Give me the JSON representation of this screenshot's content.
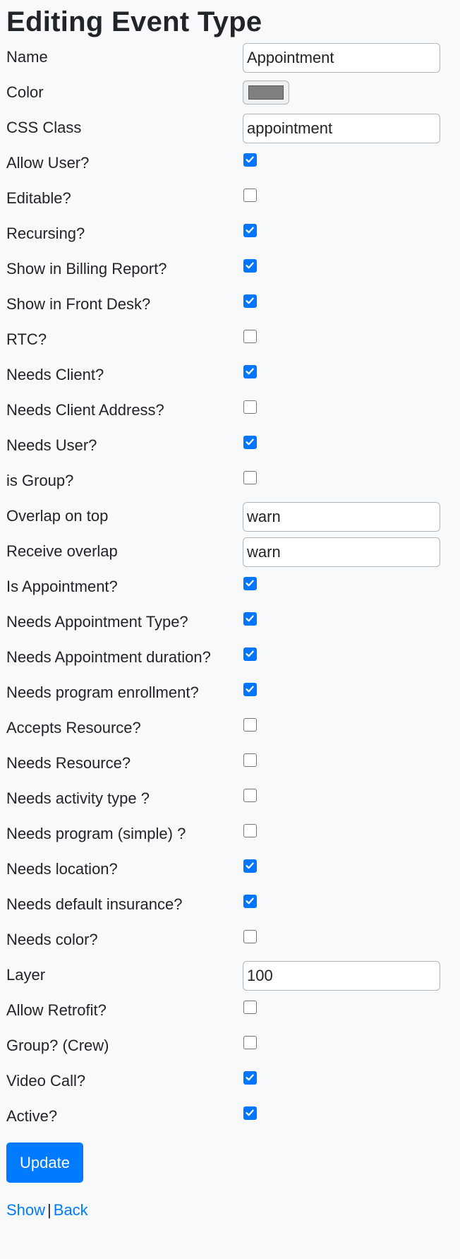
{
  "page": {
    "title": "Editing Event Type"
  },
  "fields": [
    {
      "key": "name",
      "label": "Name",
      "type": "text",
      "value": "Appointment"
    },
    {
      "key": "color",
      "label": "Color",
      "type": "color",
      "value": "#808080"
    },
    {
      "key": "css_class",
      "label": "CSS Class",
      "type": "text",
      "value": "appointment"
    },
    {
      "key": "allow_user",
      "label": "Allow User?",
      "type": "checkbox",
      "checked": true
    },
    {
      "key": "editable",
      "label": "Editable?",
      "type": "checkbox",
      "checked": false
    },
    {
      "key": "recursing",
      "label": "Recursing?",
      "type": "checkbox",
      "checked": true
    },
    {
      "key": "show_in_billing_report",
      "label": "Show in Billing Report?",
      "type": "checkbox",
      "checked": true
    },
    {
      "key": "show_in_front_desk",
      "label": "Show in Front Desk?",
      "type": "checkbox",
      "checked": true
    },
    {
      "key": "rtc",
      "label": "RTC?",
      "type": "checkbox",
      "checked": false
    },
    {
      "key": "needs_client",
      "label": "Needs Client?",
      "type": "checkbox",
      "checked": true
    },
    {
      "key": "needs_client_address",
      "label": "Needs Client Address?",
      "type": "checkbox",
      "checked": false
    },
    {
      "key": "needs_user",
      "label": "Needs User?",
      "type": "checkbox",
      "checked": true
    },
    {
      "key": "is_group",
      "label": "is Group?",
      "type": "checkbox",
      "checked": false
    },
    {
      "key": "overlap_on_top",
      "label": "Overlap on top",
      "type": "text",
      "value": "warn"
    },
    {
      "key": "receive_overlap",
      "label": "Receive overlap",
      "type": "text",
      "value": "warn"
    },
    {
      "key": "is_appointment",
      "label": "Is Appointment?",
      "type": "checkbox",
      "checked": true
    },
    {
      "key": "needs_appointment_type",
      "label": "Needs Appointment Type?",
      "type": "checkbox",
      "checked": true
    },
    {
      "key": "needs_appointment_duration",
      "label": "Needs Appointment duration?",
      "type": "checkbox",
      "checked": true
    },
    {
      "key": "needs_program_enrollment",
      "label": "Needs program enrollment?",
      "type": "checkbox",
      "checked": true
    },
    {
      "key": "accepts_resource",
      "label": "Accepts Resource?",
      "type": "checkbox",
      "checked": false
    },
    {
      "key": "needs_resource",
      "label": "Needs Resource?",
      "type": "checkbox",
      "checked": false
    },
    {
      "key": "needs_activity_type",
      "label": "Needs activity type ?",
      "type": "checkbox",
      "checked": false
    },
    {
      "key": "needs_program_simple",
      "label": "Needs program (simple) ?",
      "type": "checkbox",
      "checked": false
    },
    {
      "key": "needs_location",
      "label": "Needs location?",
      "type": "checkbox",
      "checked": true
    },
    {
      "key": "needs_default_insurance",
      "label": "Needs default insurance?",
      "type": "checkbox",
      "checked": true
    },
    {
      "key": "needs_color",
      "label": "Needs color?",
      "type": "checkbox",
      "checked": false
    },
    {
      "key": "layer",
      "label": "Layer",
      "type": "text",
      "value": "100"
    },
    {
      "key": "allow_retrofit",
      "label": "Allow Retrofit?",
      "type": "checkbox",
      "checked": false
    },
    {
      "key": "group_crew",
      "label": "Group? (Crew)",
      "type": "checkbox",
      "checked": false
    },
    {
      "key": "video_call",
      "label": "Video Call?",
      "type": "checkbox",
      "checked": true
    },
    {
      "key": "active",
      "label": "Active?",
      "type": "checkbox",
      "checked": true
    }
  ],
  "actions": {
    "submit_label": "Update",
    "show_link": "Show",
    "separator": "|",
    "back_link": "Back"
  },
  "colors": {
    "primary": "#007bff",
    "checkbox_checked": "#0075ff",
    "background": "#f8f9fa",
    "text": "#212529"
  }
}
